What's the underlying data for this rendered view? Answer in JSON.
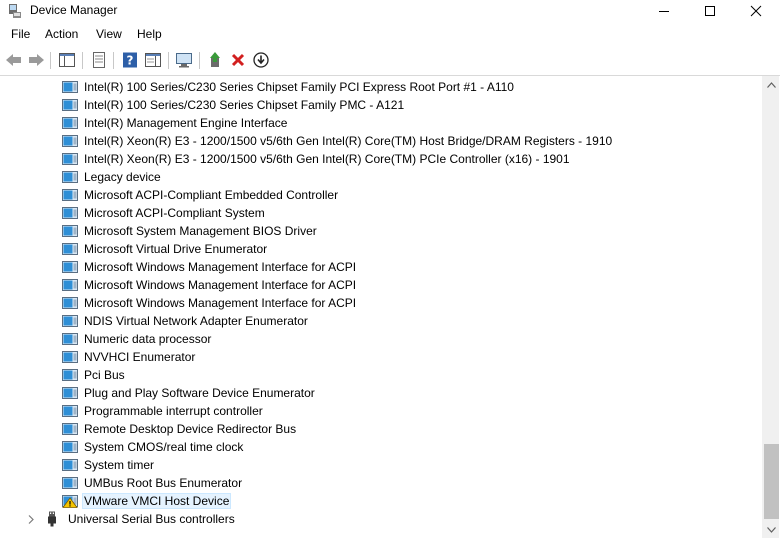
{
  "window": {
    "title": "Device Manager"
  },
  "menu": {
    "items": [
      "File",
      "Action",
      "View",
      "Help"
    ]
  },
  "toolbar": {
    "buttons": [
      "back-icon",
      "forward-icon",
      "show-hide-console-tree-icon",
      "properties-icon",
      "help-icon",
      "action-pane-icon",
      "scan-hardware-icon",
      "update-driver-icon",
      "uninstall-icon",
      "disable-device-icon"
    ]
  },
  "tree": {
    "devices": [
      "Intel(R) 100 Series/C230 Series Chipset Family PCI Express Root Port #1 - A110",
      "Intel(R) 100 Series/C230 Series Chipset Family PMC - A121",
      "Intel(R) Management Engine Interface",
      "Intel(R) Xeon(R) E3 - 1200/1500 v5/6th Gen Intel(R) Core(TM) Host Bridge/DRAM Registers - 1910",
      "Intel(R) Xeon(R) E3 - 1200/1500 v5/6th Gen Intel(R) Core(TM) PCIe Controller (x16) - 1901",
      "Legacy device",
      "Microsoft ACPI-Compliant Embedded Controller",
      "Microsoft ACPI-Compliant System",
      "Microsoft System Management BIOS Driver",
      "Microsoft Virtual Drive Enumerator",
      "Microsoft Windows Management Interface for ACPI",
      "Microsoft Windows Management Interface for ACPI",
      "Microsoft Windows Management Interface for ACPI",
      "NDIS Virtual Network Adapter Enumerator",
      "Numeric data processor",
      "NVVHCI Enumerator",
      "Pci Bus",
      "Plug and Play Software Device Enumerator",
      "Programmable interrupt controller",
      "Remote Desktop Device Redirector Bus",
      "System CMOS/real time clock",
      "System timer",
      "UMBus Root Bus Enumerator",
      "VMware VMCI Host Device"
    ],
    "warning_device": "VMware VMCI Host Device",
    "category": "Universal Serial Bus controllers"
  },
  "colors": {
    "selection_bg": "#e5f3ff",
    "selection_border": "#cce8ff",
    "device_icon_blue": "#2f8fd6",
    "warning_yellow": "#f5c400",
    "uninstall_red": "#d21f1f",
    "update_green": "#3a9a3a"
  }
}
